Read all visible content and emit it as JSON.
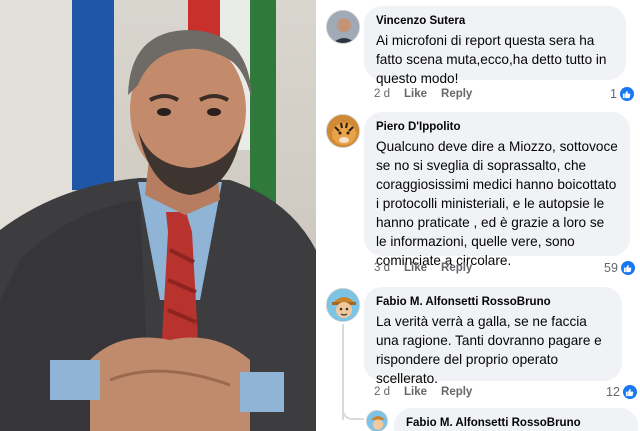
{
  "comments": [
    {
      "author": "Vincenzo Sutera",
      "text": "Ai microfoni di report questa sera ha fatto scena muta,ecco,ha detto tutto in questo modo!",
      "time": "2 d",
      "like_label": "Like",
      "reply_label": "Reply",
      "reaction_count": "1",
      "reaction_icon": "thumbs-up-icon"
    },
    {
      "author": "Piero D'Ippolito",
      "text": "Qualcuno deve dire a Miozzo, sottovoce se no si sveglia di soprassalto, che coraggiosissimi medici hanno boicottato i protocolli ministeriali, e le autopsie le hanno praticate , ed è grazie a loro se le informazioni, quelle vere, sono cominciate a circolare.",
      "time": "3 d",
      "like_label": "Like",
      "reply_label": "Reply",
      "reaction_count": "59",
      "reaction_icon": "thumbs-up-icon"
    },
    {
      "author": "Fabio M. Alfonsetti RossoBruno",
      "text": "La verità verrà a galla, se ne faccia una ragione. Tanti dovranno pagare e rispondere del proprio operato scellerato.",
      "time": "2 d",
      "like_label": "Like",
      "reply_label": "Reply",
      "reaction_count": "12",
      "reaction_icon": "thumbs-up-icon"
    },
    {
      "author": "Fabio M. Alfonsetti RossoBruno"
    }
  ],
  "colors": {
    "bubble_bg": "#f0f2f5",
    "text": "#050505",
    "meta": "#65676b",
    "like_blue": "#1877f2"
  }
}
